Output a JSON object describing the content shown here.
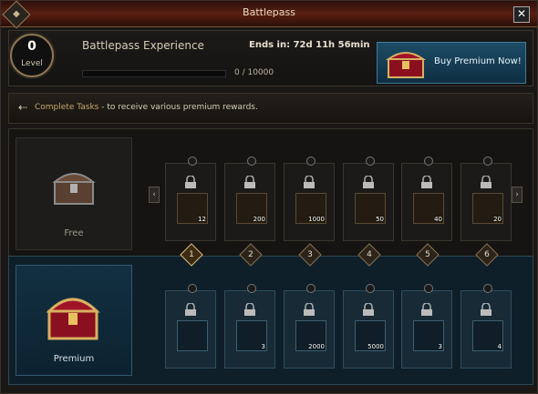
{
  "window": {
    "title": "Battlepass",
    "close_label": "✕"
  },
  "level": {
    "value": "0",
    "label": "Level"
  },
  "experience": {
    "title": "Battlepass Experience",
    "progress_text": "0 / 10000",
    "progress": 0
  },
  "ends_in": "Ends in: 72d 11h 56min",
  "buy_button": {
    "label": "Buy Premium Now!"
  },
  "info": {
    "highlight": "Complete Tasks",
    "rest": " - to receive various premium rewards."
  },
  "tracks": {
    "free": {
      "label": "Free"
    },
    "premium": {
      "label": "Premium"
    }
  },
  "levels": [
    "1",
    "2",
    "3",
    "4",
    "5",
    "6"
  ],
  "free_rewards": [
    {
      "icon": "golden-bird-icon",
      "qty": "12"
    },
    {
      "icon": "rainbow-orb-icon",
      "qty": "200"
    },
    {
      "icon": "silver-ore-icon",
      "qty": "1000"
    },
    {
      "icon": "tree-totem-icon",
      "qty": "50"
    },
    {
      "icon": "wing-scroll-icon",
      "qty": "40"
    },
    {
      "icon": "wooden-crate-icon",
      "qty": "20"
    }
  ],
  "premium_rewards": [
    {
      "icon": "treasure-chest-icon",
      "qty": ""
    },
    {
      "icon": "blue-book-icon",
      "qty": "3"
    },
    {
      "icon": "silver-ore-icon",
      "qty": "2000"
    },
    {
      "icon": "green-gem-pile-icon",
      "qty": "5000"
    },
    {
      "icon": "green-crystal-icon",
      "qty": "3"
    },
    {
      "icon": "white-flame-icon",
      "qty": "4"
    }
  ],
  "colors": {
    "accent_title": "#5a1e12",
    "premium_blue": "#123042",
    "gold": "#c8a86a"
  }
}
